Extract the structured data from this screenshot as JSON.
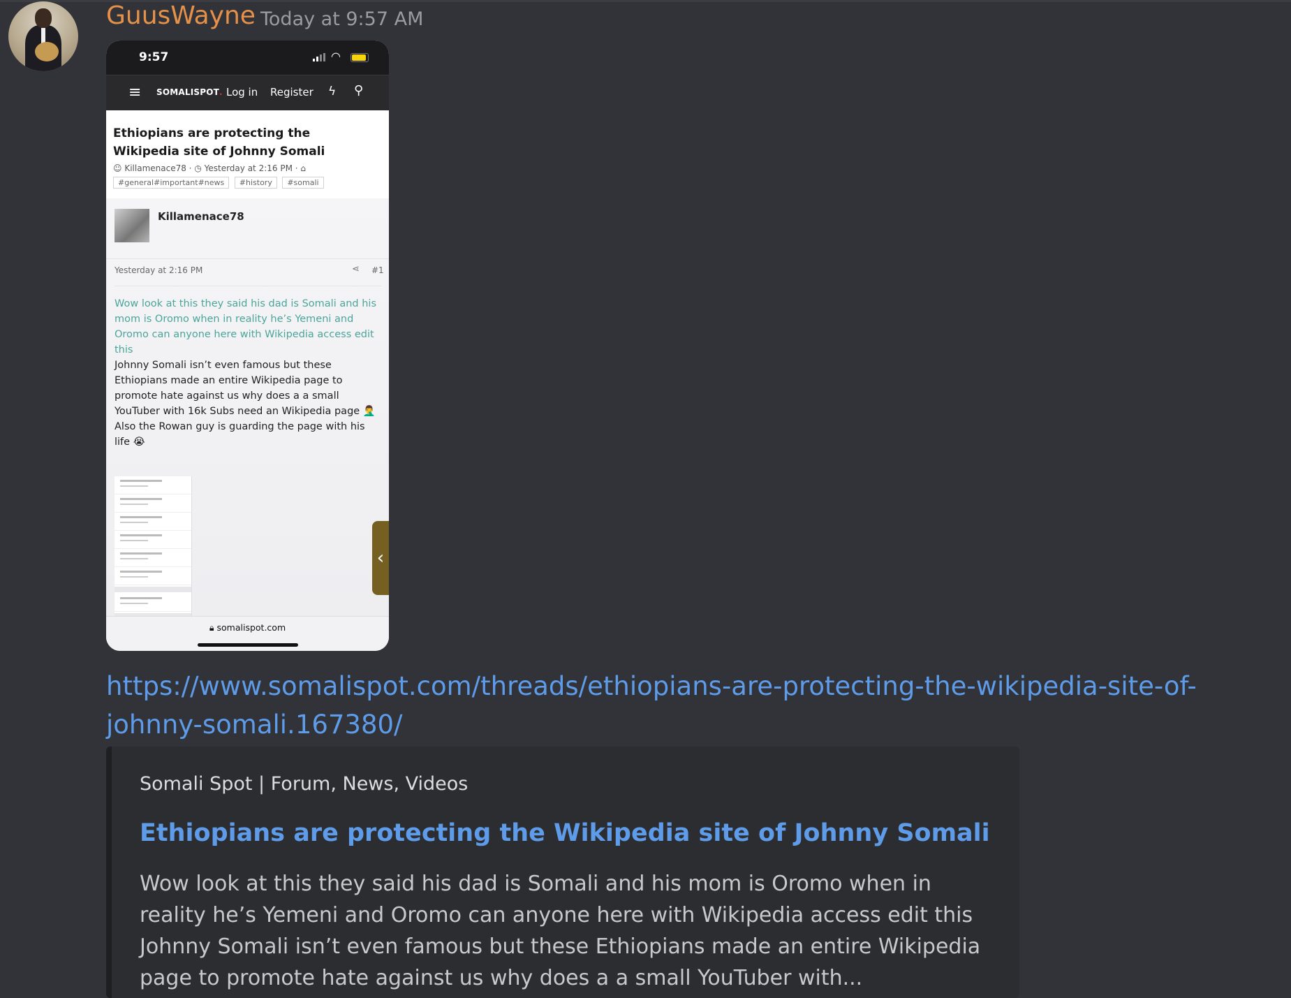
{
  "message": {
    "username": "GuusWayne",
    "timestamp": "Today at 9:57 AM",
    "username_color": "#e6914a",
    "link_url": "https://www.somalispot.com/threads/ethiopians-are-protecting-the-wikipedia-site-of-johnny-somali.167380/"
  },
  "screenshot": {
    "status_time": "9:57",
    "nav": {
      "logo": "SOMALISPOT",
      "logo_dot": ".",
      "login": "Log in",
      "register": "Register"
    },
    "thread_title": "Ethiopians are protecting the Wikipedia site of Johnny Somali",
    "meta_author": "Killamenace78",
    "meta_date": "Yesterday at 2:16 PM",
    "tags": [
      "#general#important#news",
      "#history",
      "#somali"
    ],
    "post": {
      "author": "Killamenace78",
      "date": "Yesterday at 2:16 PM",
      "number": "#1",
      "quote": "Wow look at this they said his dad is Somali and his mom is Oromo when in reality he’s Yemeni and Oromo can anyone here with Wikipedia access edit this",
      "body1": "Johnny Somali isn’t even famous but these Ethiopians made an entire Wikipedia page to promote hate against us why does a a small YouTuber with 16k Subs need an Wikipedia page 🤦‍♂️",
      "body2": "Also the Rowan guy is guarding the page with his life 😭"
    },
    "url_bar": "somalispot.com"
  },
  "embed": {
    "provider": "Somali Spot | Forum, News, Videos",
    "title": "Ethiopians are protecting the Wikipedia site of Johnny Somali",
    "description": "Wow look at this they said his dad is Somali and his mom is Oromo when in reality he’s Yemeni and Oromo can anyone here with Wikipedia access edit this Johnny Somali isn’t even famous but these Ethiopians made an entire Wikipedia page to promote hate against us why does a a small YouTuber with..."
  },
  "icons": {
    "menu": "hamburger-icon",
    "bolt": "lightning-icon",
    "search": "search-icon",
    "share": "share-icon",
    "lock": "lock-icon",
    "chevron": "chevron-left-icon"
  }
}
